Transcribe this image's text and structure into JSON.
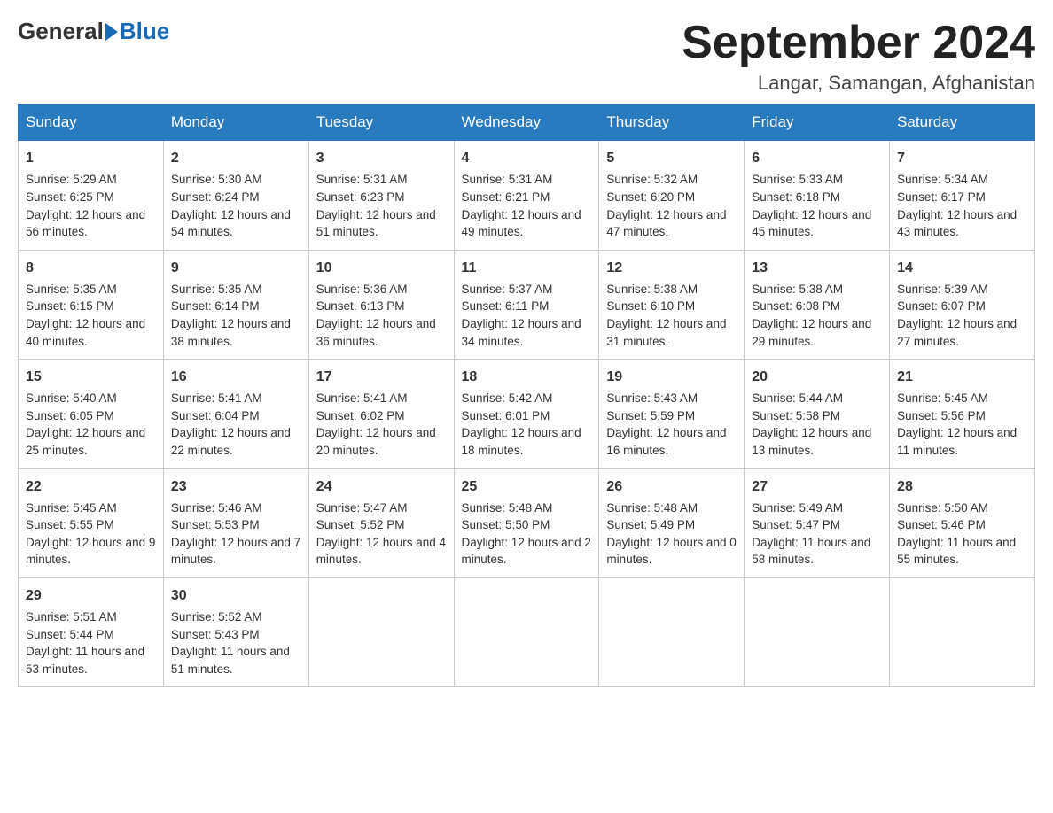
{
  "header": {
    "logo": {
      "general": "General",
      "blue": "Blue"
    },
    "title": "September 2024",
    "location": "Langar, Samangan, Afghanistan"
  },
  "weekdays": [
    "Sunday",
    "Monday",
    "Tuesday",
    "Wednesday",
    "Thursday",
    "Friday",
    "Saturday"
  ],
  "weeks": [
    [
      {
        "day": "1",
        "sunrise": "5:29 AM",
        "sunset": "6:25 PM",
        "daylight": "12 hours and 56 minutes."
      },
      {
        "day": "2",
        "sunrise": "5:30 AM",
        "sunset": "6:24 PM",
        "daylight": "12 hours and 54 minutes."
      },
      {
        "day": "3",
        "sunrise": "5:31 AM",
        "sunset": "6:23 PM",
        "daylight": "12 hours and 51 minutes."
      },
      {
        "day": "4",
        "sunrise": "5:31 AM",
        "sunset": "6:21 PM",
        "daylight": "12 hours and 49 minutes."
      },
      {
        "day": "5",
        "sunrise": "5:32 AM",
        "sunset": "6:20 PM",
        "daylight": "12 hours and 47 minutes."
      },
      {
        "day": "6",
        "sunrise": "5:33 AM",
        "sunset": "6:18 PM",
        "daylight": "12 hours and 45 minutes."
      },
      {
        "day": "7",
        "sunrise": "5:34 AM",
        "sunset": "6:17 PM",
        "daylight": "12 hours and 43 minutes."
      }
    ],
    [
      {
        "day": "8",
        "sunrise": "5:35 AM",
        "sunset": "6:15 PM",
        "daylight": "12 hours and 40 minutes."
      },
      {
        "day": "9",
        "sunrise": "5:35 AM",
        "sunset": "6:14 PM",
        "daylight": "12 hours and 38 minutes."
      },
      {
        "day": "10",
        "sunrise": "5:36 AM",
        "sunset": "6:13 PM",
        "daylight": "12 hours and 36 minutes."
      },
      {
        "day": "11",
        "sunrise": "5:37 AM",
        "sunset": "6:11 PM",
        "daylight": "12 hours and 34 minutes."
      },
      {
        "day": "12",
        "sunrise": "5:38 AM",
        "sunset": "6:10 PM",
        "daylight": "12 hours and 31 minutes."
      },
      {
        "day": "13",
        "sunrise": "5:38 AM",
        "sunset": "6:08 PM",
        "daylight": "12 hours and 29 minutes."
      },
      {
        "day": "14",
        "sunrise": "5:39 AM",
        "sunset": "6:07 PM",
        "daylight": "12 hours and 27 minutes."
      }
    ],
    [
      {
        "day": "15",
        "sunrise": "5:40 AM",
        "sunset": "6:05 PM",
        "daylight": "12 hours and 25 minutes."
      },
      {
        "day": "16",
        "sunrise": "5:41 AM",
        "sunset": "6:04 PM",
        "daylight": "12 hours and 22 minutes."
      },
      {
        "day": "17",
        "sunrise": "5:41 AM",
        "sunset": "6:02 PM",
        "daylight": "12 hours and 20 minutes."
      },
      {
        "day": "18",
        "sunrise": "5:42 AM",
        "sunset": "6:01 PM",
        "daylight": "12 hours and 18 minutes."
      },
      {
        "day": "19",
        "sunrise": "5:43 AM",
        "sunset": "5:59 PM",
        "daylight": "12 hours and 16 minutes."
      },
      {
        "day": "20",
        "sunrise": "5:44 AM",
        "sunset": "5:58 PM",
        "daylight": "12 hours and 13 minutes."
      },
      {
        "day": "21",
        "sunrise": "5:45 AM",
        "sunset": "5:56 PM",
        "daylight": "12 hours and 11 minutes."
      }
    ],
    [
      {
        "day": "22",
        "sunrise": "5:45 AM",
        "sunset": "5:55 PM",
        "daylight": "12 hours and 9 minutes."
      },
      {
        "day": "23",
        "sunrise": "5:46 AM",
        "sunset": "5:53 PM",
        "daylight": "12 hours and 7 minutes."
      },
      {
        "day": "24",
        "sunrise": "5:47 AM",
        "sunset": "5:52 PM",
        "daylight": "12 hours and 4 minutes."
      },
      {
        "day": "25",
        "sunrise": "5:48 AM",
        "sunset": "5:50 PM",
        "daylight": "12 hours and 2 minutes."
      },
      {
        "day": "26",
        "sunrise": "5:48 AM",
        "sunset": "5:49 PM",
        "daylight": "12 hours and 0 minutes."
      },
      {
        "day": "27",
        "sunrise": "5:49 AM",
        "sunset": "5:47 PM",
        "daylight": "11 hours and 58 minutes."
      },
      {
        "day": "28",
        "sunrise": "5:50 AM",
        "sunset": "5:46 PM",
        "daylight": "11 hours and 55 minutes."
      }
    ],
    [
      {
        "day": "29",
        "sunrise": "5:51 AM",
        "sunset": "5:44 PM",
        "daylight": "11 hours and 53 minutes."
      },
      {
        "day": "30",
        "sunrise": "5:52 AM",
        "sunset": "5:43 PM",
        "daylight": "11 hours and 51 minutes."
      },
      null,
      null,
      null,
      null,
      null
    ]
  ],
  "labels": {
    "sunrise": "Sunrise:",
    "sunset": "Sunset:",
    "daylight": "Daylight:"
  }
}
